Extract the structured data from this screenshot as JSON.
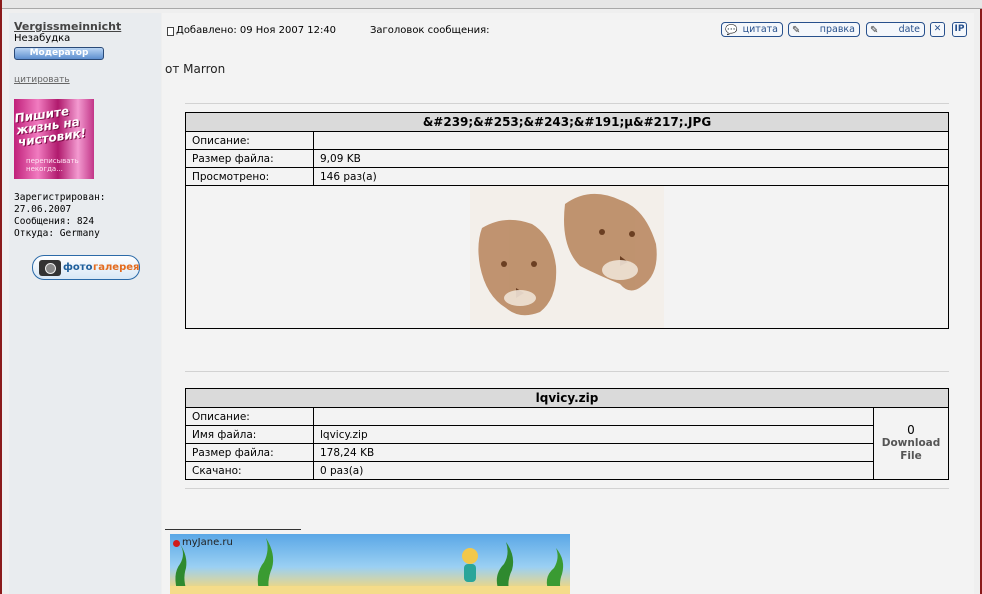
{
  "user": {
    "name": "Vergissmeinnicht",
    "title": "Незабудка",
    "rank": "Модератор",
    "quote_link": "цитировать",
    "avatar_text": "Пишите жизнь на чистовик!",
    "avatar_subtext": "переписывать некогда...",
    "registered_label": "Зарегистрирован:",
    "registered_date": "27.06.2007",
    "messages": "Сообщения: 824",
    "location": "Откуда: Germany",
    "gallery": {
      "part1": "фото",
      "part2": "галерея"
    }
  },
  "post": {
    "added": "Добавлено: 09 Ноя 2007 12:40",
    "subject": "Заголовок сообщения:",
    "from": "от Marron",
    "buttons": {
      "quote": "цитата",
      "edit": "правка",
      "date": "date",
      "delete": "✕",
      "ip": "IP"
    }
  },
  "attachment1": {
    "title": "&#239;&#253;&#243;&#191;µ&#217;.JPG",
    "rows": [
      {
        "label": "Описание:",
        "value": ""
      },
      {
        "label": "Размер файла:",
        "value": "9,09 KB"
      },
      {
        "label": "Просмотрено:",
        "value": "146 раз(а)"
      }
    ]
  },
  "attachment2": {
    "title": "lqvicy.zip",
    "rows": [
      {
        "label": "Описание:",
        "value": ""
      },
      {
        "label": "Имя файла:",
        "value": "lqvicy.zip"
      },
      {
        "label": "Размер файла:",
        "value": "178,24 KB"
      },
      {
        "label": "Скачано:",
        "value": "0 раз(а)"
      }
    ],
    "download_count": "0",
    "download_label": "Download File"
  },
  "signature": {
    "banner_text": "myJane.ru"
  }
}
